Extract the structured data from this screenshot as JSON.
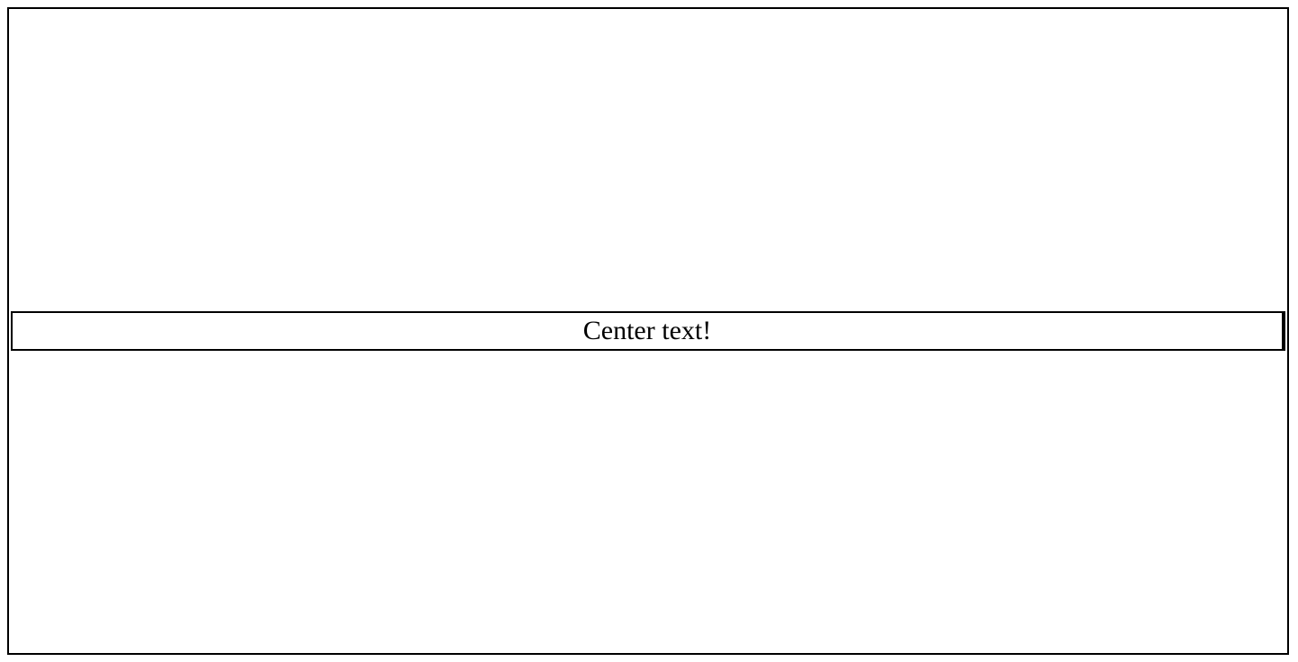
{
  "main": {
    "center_text": "Center text!"
  }
}
